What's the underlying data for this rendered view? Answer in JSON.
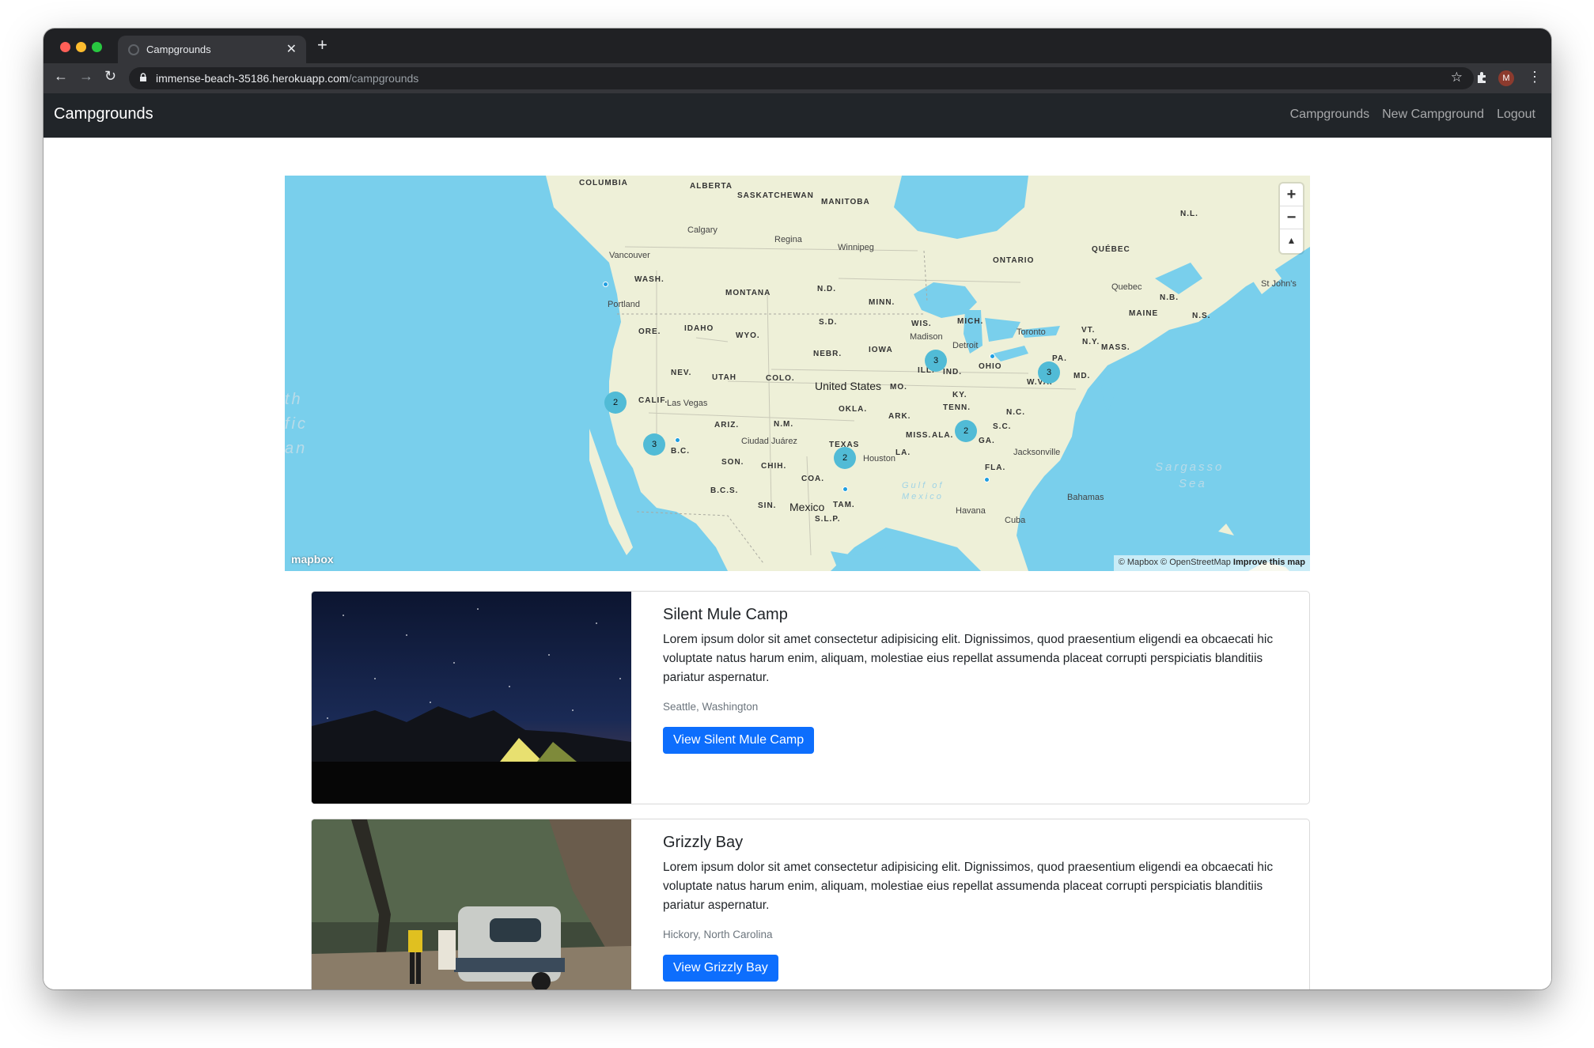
{
  "browser": {
    "tab_title": "Campgrounds",
    "url_host": "immense-beach-35186.herokuapp.com",
    "url_path": "/campgrounds",
    "profile_initial": "M"
  },
  "navbar": {
    "brand": "Campgrounds",
    "links": [
      "Campgrounds",
      "New Campground",
      "Logout"
    ]
  },
  "map": {
    "labels": [
      "COLUMBIA",
      "ALBERTA",
      "SASKATCHEWAN",
      "MANITOBA",
      "N.L.",
      "QUÉBEC",
      "ONTARIO",
      "WASH.",
      "MONTANA",
      "N.D.",
      "MINN.",
      "MAINE",
      "N.B.",
      "N.S.",
      "ORE.",
      "IDAHO",
      "S.D.",
      "WIS.",
      "MICH.",
      "VT.",
      "N.Y.",
      "MASS.",
      "WYO.",
      "NEBR.",
      "IOWA",
      "PA.",
      "NEV.",
      "UTAH",
      "COLO.",
      "ILL.",
      "IND.",
      "OHIO",
      "MD.",
      "W.VA.",
      "CALIF.",
      "MO.",
      "KY.",
      "OKLA.",
      "ARK.",
      "TENN.",
      "N.C.",
      "ARIZ.",
      "N.M.",
      "S.C.",
      "TEXAS",
      "MISS.",
      "ALA.",
      "GA.",
      "LA.",
      "FLA.",
      "B.C.",
      "SON.",
      "CHIH.",
      "COA.",
      "B.C.S.",
      "SIN.",
      "TAM.",
      "S.L.P."
    ],
    "cities": [
      "Calgary",
      "Regina",
      "Winnipeg",
      "Vancouver",
      "Portland",
      "Madison",
      "Detroit",
      "Toronto",
      "Quebec",
      "St John's",
      "Las Vegas",
      "Ciudad Juárez",
      "Houston",
      "Jacksonville",
      "Bahamas",
      "Havana",
      "Cuba"
    ],
    "country": "United States",
    "country2": "Mexico",
    "sea1": "Sargasso",
    "sea2": "Sea",
    "gulf1": "Gulf of",
    "gulf2": "Mexico",
    "ocean": [
      "th",
      "fic",
      "an"
    ],
    "clusters": [
      "3",
      "3",
      "2",
      "3",
      "2",
      "2"
    ],
    "zoom_in": "+",
    "zoom_out": "−",
    "compass": "▲",
    "logo": "mapbox",
    "attribution": "© Mapbox © OpenStreetMap",
    "improve": "Improve this map"
  },
  "campgrounds": [
    {
      "title": "Silent Mule Camp",
      "description": "Lorem ipsum dolor sit amet consectetur adipisicing elit. Dignissimos, quod praesentium eligendi ea obcaecati hic voluptate natus harum enim, aliquam, molestiae eius repellat assumenda placeat corrupti perspiciatis blanditiis pariatur aspernatur.",
      "location": "Seattle, Washington",
      "button": "View Silent Mule Camp"
    },
    {
      "title": "Grizzly Bay",
      "description": "Lorem ipsum dolor sit amet consectetur adipisicing elit. Dignissimos, quod praesentium eligendi ea obcaecati hic voluptate natus harum enim, aliquam, molestiae eius repellat assumenda placeat corrupti perspiciatis blanditiis pariatur aspernatur.",
      "location": "Hickory, North Carolina",
      "button": "View Grizzly Bay"
    }
  ],
  "colors": {
    "navbar": "#212529",
    "primary_button": "#0d6efd",
    "map_water": "#79cfec",
    "map_land": "#eef0d8",
    "cluster": "#51bbd6"
  }
}
